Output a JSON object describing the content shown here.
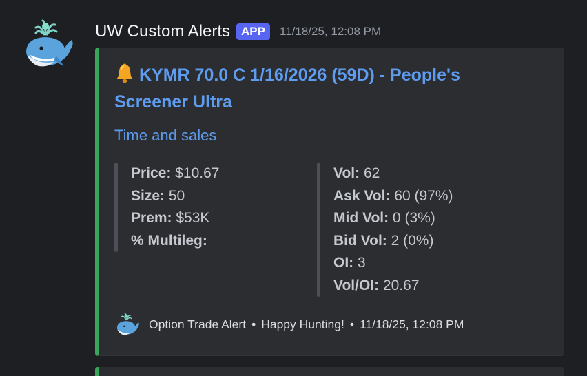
{
  "message": {
    "username": "UW Custom Alerts",
    "badge": "APP",
    "timestamp": "11/18/25, 12:08 PM",
    "avatar_icon": "whale-icon"
  },
  "embed": {
    "accent_color": "#3ba55c",
    "title_icon": "bell-icon",
    "title": "KYMR 70.0 C 1/16/2026 (59D) - People's Screener Ultra",
    "description": "Time and sales",
    "fields_left": [
      {
        "key": "Price:",
        "value": " $10.67"
      },
      {
        "key": "Size:",
        "value": " 50"
      },
      {
        "key": "Prem:",
        "value": " $53K"
      },
      {
        "key": "% Multileg:",
        "value": ""
      }
    ],
    "fields_right": [
      {
        "key": "Vol:",
        "value": " 62"
      },
      {
        "key": "Ask Vol:",
        "value": " 60 (97%)"
      },
      {
        "key": "Mid Vol:",
        "value": " 0 (3%)"
      },
      {
        "key": "Bid Vol:",
        "value": " 2 (0%)"
      },
      {
        "key": "OI:",
        "value": " 3"
      },
      {
        "key": "Vol/OI:",
        "value": " 20.67"
      }
    ],
    "footer": {
      "icon": "whale-icon",
      "text1": "Option Trade Alert",
      "separator": "•",
      "text2": "Happy Hunting!",
      "text3": "11/18/25, 12:08 PM"
    }
  },
  "colors": {
    "background": "#1e1f23",
    "embed_bg": "#2b2d31",
    "link": "#5e9cf0",
    "badge": "#5865f2"
  }
}
